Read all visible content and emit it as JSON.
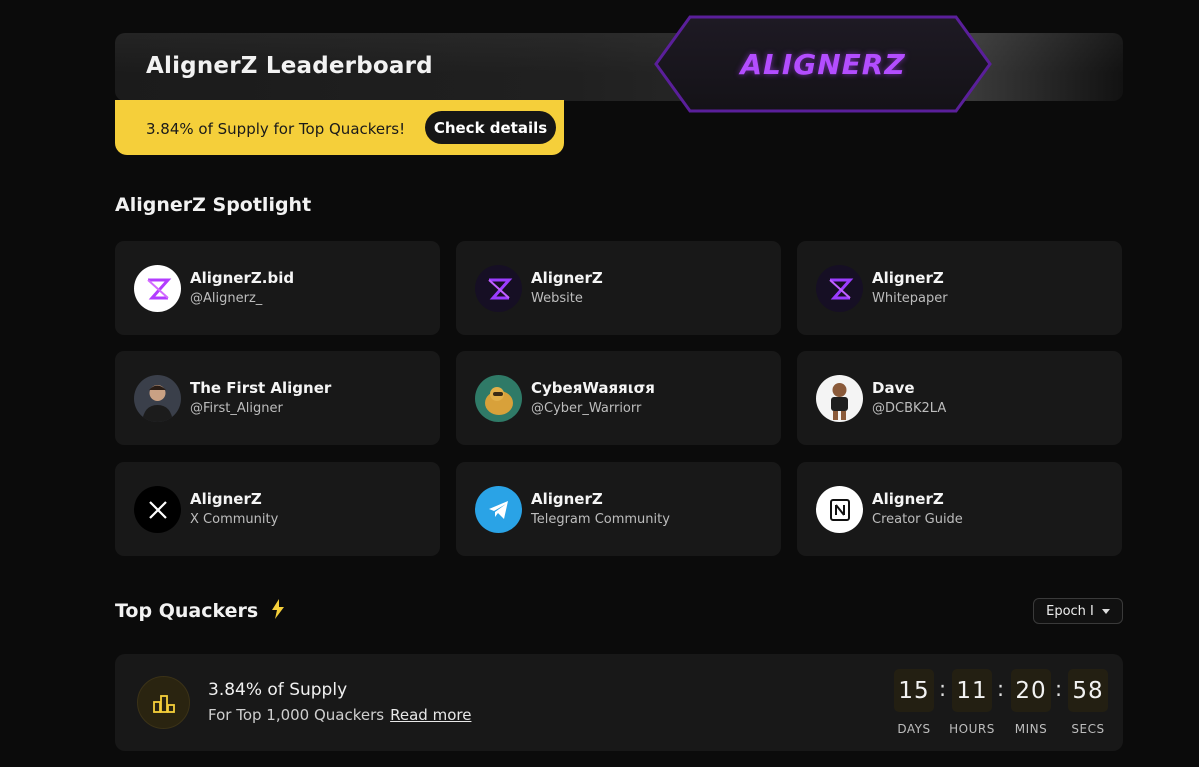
{
  "header": {
    "title": "AlignerZ Leaderboard",
    "logo_text": "ALIGNERZ",
    "promo_text": "3.84% of Supply for Top Quackers!",
    "promo_button": "Check details"
  },
  "spotlight": {
    "title": "AlignerZ Spotlight",
    "cards": [
      {
        "name": "AlignerZ.bid",
        "sub": "@Alignerz_",
        "icon": "alignerz-logo-icon"
      },
      {
        "name": "AlignerZ",
        "sub": "Website",
        "icon": "alignerz-logo-icon"
      },
      {
        "name": "AlignerZ",
        "sub": "Whitepaper",
        "icon": "alignerz-logo-icon"
      },
      {
        "name": "The First Aligner",
        "sub": "@First_Aligner",
        "icon": "user-avatar"
      },
      {
        "name": "CуbeяWaяяισя",
        "sub": "@Cyber_Warriorr",
        "icon": "user-avatar"
      },
      {
        "name": "Dave",
        "sub": "@DCBK2LA",
        "icon": "user-avatar"
      },
      {
        "name": "AlignerZ",
        "sub": "X Community",
        "icon": "x-icon"
      },
      {
        "name": "AlignerZ",
        "sub": "Telegram Community",
        "icon": "telegram-icon"
      },
      {
        "name": "AlignerZ",
        "sub": "Creator Guide",
        "icon": "notion-icon"
      }
    ]
  },
  "quackers": {
    "title": "Top Quackers",
    "epoch_label": "Epoch I",
    "card_title": "3.84% of Supply",
    "card_sub": "For Top 1,000 Quackers",
    "read_more": "Read more",
    "timer": {
      "days": "15",
      "hours": "11",
      "mins": "20",
      "secs": "58",
      "days_label": "DAYS",
      "hours_label": "HOURS",
      "mins_label": "MINS",
      "secs_label": "SECS"
    }
  },
  "colors": {
    "accent_yellow": "#f5cf3a",
    "brand_purple": "#b34dff",
    "background": "#0b0b0b",
    "card": "#181818"
  }
}
